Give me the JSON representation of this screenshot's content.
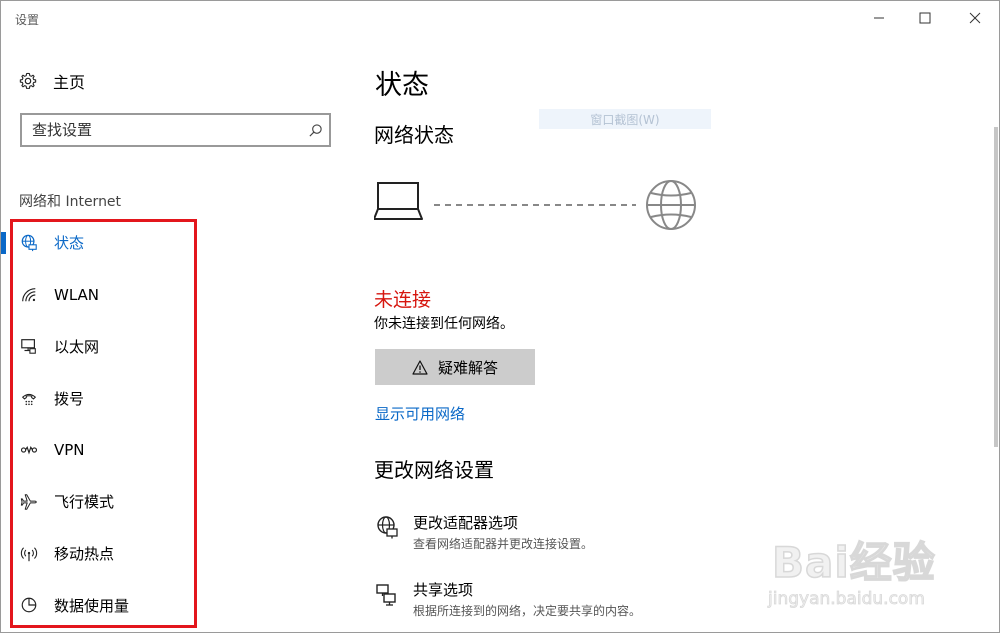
{
  "window": {
    "title": "设置"
  },
  "sidebar": {
    "home_label": "主页",
    "search": {
      "placeholder": "查找设置"
    },
    "section_label": "网络和 Internet",
    "items": [
      {
        "label": "状态",
        "icon": "globe-status-icon",
        "active": true
      },
      {
        "label": "WLAN",
        "icon": "wifi-icon"
      },
      {
        "label": "以太网",
        "icon": "ethernet-icon"
      },
      {
        "label": "拨号",
        "icon": "dialup-icon"
      },
      {
        "label": "VPN",
        "icon": "vpn-icon"
      },
      {
        "label": "飞行模式",
        "icon": "airplane-icon"
      },
      {
        "label": "移动热点",
        "icon": "hotspot-icon"
      },
      {
        "label": "数据使用量",
        "icon": "data-usage-icon"
      }
    ]
  },
  "main": {
    "page_title": "状态",
    "network_status_title": "网络状态",
    "ghost_tooltip": "窗口截图(W)",
    "connection_status": "未连接",
    "connection_desc": "你未连接到任何网络。",
    "troubleshoot_label": "疑难解答",
    "show_networks_link": "显示可用网络",
    "change_settings_title": "更改网络设置",
    "options": [
      {
        "title": "更改适配器选项",
        "desc": "查看网络适配器并更改连接设置。",
        "icon": "adapter-icon"
      },
      {
        "title": "共享选项",
        "desc": "根据所连接到的网络，决定要共享的内容。",
        "icon": "sharing-icon"
      }
    ]
  },
  "watermark": {
    "brand": "Bai经验",
    "url": "jingyan.baidu.com"
  },
  "colors": {
    "accent": "#0a68c7",
    "error": "#d6160e",
    "highlight_box": "#e3161c",
    "button_bg": "#cccccc"
  }
}
